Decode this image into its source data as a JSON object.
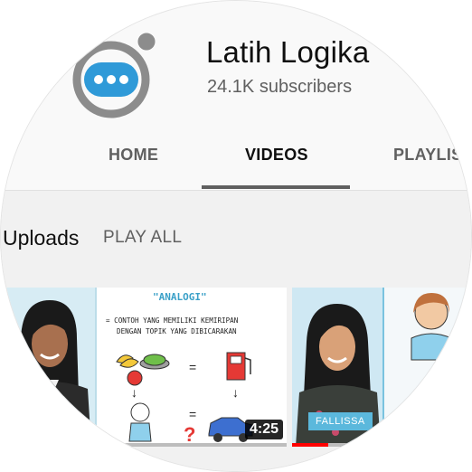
{
  "channel": {
    "title": "Latih Logika",
    "subscribers": "24.1K subscribers",
    "avatar_icon": "chat-bubble-dots-icon",
    "accent": "#2f9ad8"
  },
  "tabs": [
    {
      "label": "HOME",
      "active": false
    },
    {
      "label": "VIDEOS",
      "active": true
    },
    {
      "label": "PLAYLIS",
      "active": false
    }
  ],
  "section": {
    "title": "Uploads",
    "play_all": "PLAY ALL"
  },
  "videos": [
    {
      "duration": "4:25",
      "watched_fraction": 0.0,
      "board": {
        "title": "\"ANALOGI\"",
        "line1": "= CONTOH YANG MEMILIKI KEMIRIPAN",
        "line2": "DENGAN TOPIK YANG DIBICARAKAN",
        "eq1": "=",
        "eq2": "=",
        "arrow1": "↓",
        "arrow2": "↓",
        "question": "?"
      }
    },
    {
      "name_card": "FALLISSA",
      "watched_fraction": 0.2
    }
  ],
  "colors": {
    "progress": "#ff0000",
    "name_card": "#5bb8dc"
  }
}
